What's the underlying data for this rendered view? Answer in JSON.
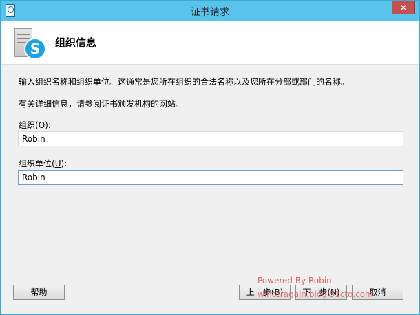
{
  "window": {
    "title": "证书请求",
    "close_glyph": "✕"
  },
  "header": {
    "title": "组织信息",
    "skype_letter": "S"
  },
  "body": {
    "description_line1": "输入组织名称和组织单位。这通常是您所在组织的合法名称以及您所在分部或部门的名称。",
    "description_line2": "有关详细信息，请参阅证书颁发机构的网站。"
  },
  "form": {
    "organization": {
      "label": "组织(",
      "mnemonic": "O",
      "label_end": "):",
      "value": "Robin"
    },
    "unit": {
      "label": "组织单位(",
      "mnemonic": "U",
      "label_end": "):",
      "value": "Robin"
    }
  },
  "buttons": {
    "help": "帮助",
    "back": "上一步(B)",
    "next": "下一步(N)",
    "cancel": "取消"
  },
  "watermark": {
    "line1": "Powered By Robin",
    "line2": "winteragain.blog.51cto.com"
  },
  "icons": {
    "app": "certificate-icon",
    "header": "skype-server-icon",
    "close": "close-icon"
  }
}
